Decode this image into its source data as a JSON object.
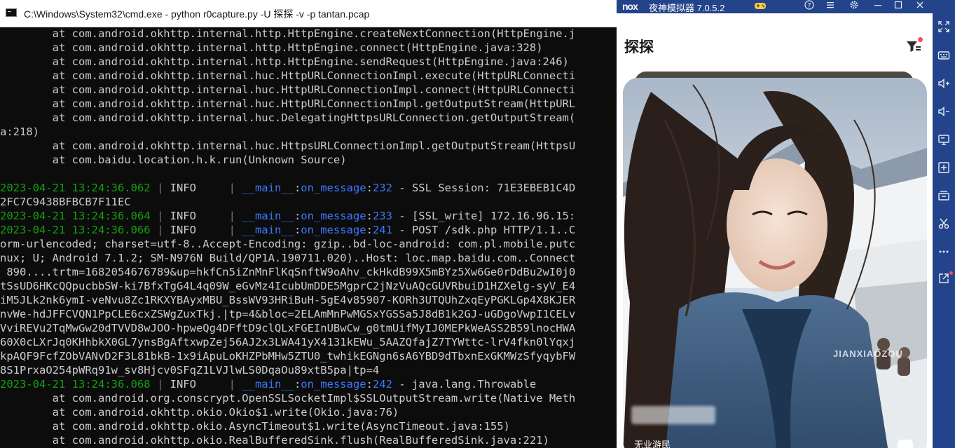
{
  "cmd": {
    "title": "C:\\Windows\\System32\\cmd.exe - python  r0capture.py -U 探探  -v -p tantan.pcap",
    "lines": [
      [
        {
          "t": "        at com.android.okhttp.internal.http.HttpEngine.createNextConnection(HttpEngine.j",
          "c": "gray"
        }
      ],
      [
        {
          "t": "        at com.android.okhttp.internal.http.HttpEngine.connect(HttpEngine.java:328)",
          "c": "gray"
        }
      ],
      [
        {
          "t": "        at com.android.okhttp.internal.http.HttpEngine.sendRequest(HttpEngine.java:246)",
          "c": "gray"
        }
      ],
      [
        {
          "t": "        at com.android.okhttp.internal.huc.HttpURLConnectionImpl.execute(HttpURLConnecti",
          "c": "gray"
        }
      ],
      [
        {
          "t": "        at com.android.okhttp.internal.huc.HttpURLConnectionImpl.connect(HttpURLConnecti",
          "c": "gray"
        }
      ],
      [
        {
          "t": "        at com.android.okhttp.internal.huc.HttpURLConnectionImpl.getOutputStream(HttpURL",
          "c": "gray"
        }
      ],
      [
        {
          "t": "        at com.android.okhttp.internal.huc.DelegatingHttpsURLConnection.getOutputStream(",
          "c": "gray"
        }
      ],
      [
        {
          "t": "a:218)",
          "c": "gray"
        }
      ],
      [
        {
          "t": "        at com.android.okhttp.internal.huc.HttpsURLConnectionImpl.getOutputStream(HttpsU",
          "c": "gray"
        }
      ],
      [
        {
          "t": "        at com.baidu.location.h.k.run(Unknown Source)",
          "c": "gray"
        }
      ],
      [
        {
          "t": "",
          "c": "gray"
        }
      ],
      [
        {
          "t": "2023-04-21 13:24:36.062",
          "c": "green"
        },
        {
          "t": " | ",
          "c": "sep"
        },
        {
          "t": "INFO",
          "c": "gray"
        },
        {
          "t": "     | ",
          "c": "sep"
        },
        {
          "t": "__main__",
          "c": "blue"
        },
        {
          "t": ":",
          "c": "gray"
        },
        {
          "t": "on_message",
          "c": "blue"
        },
        {
          "t": ":",
          "c": "gray"
        },
        {
          "t": "232",
          "c": "blue"
        },
        {
          "t": " - SSL Session: 71E3EBEB1C4D",
          "c": "gray"
        }
      ],
      [
        {
          "t": "2FC7C9438BFBCB7F11EC",
          "c": "gray"
        }
      ],
      [
        {
          "t": "2023-04-21 13:24:36.064",
          "c": "green"
        },
        {
          "t": " | ",
          "c": "sep"
        },
        {
          "t": "INFO",
          "c": "gray"
        },
        {
          "t": "     | ",
          "c": "sep"
        },
        {
          "t": "__main__",
          "c": "blue"
        },
        {
          "t": ":",
          "c": "gray"
        },
        {
          "t": "on_message",
          "c": "blue"
        },
        {
          "t": ":",
          "c": "gray"
        },
        {
          "t": "233",
          "c": "blue"
        },
        {
          "t": " - [SSL_write] 172.16.96.15:",
          "c": "gray"
        }
      ],
      [
        {
          "t": "2023-04-21 13:24:36.066",
          "c": "green"
        },
        {
          "t": " | ",
          "c": "sep"
        },
        {
          "t": "INFO",
          "c": "gray"
        },
        {
          "t": "     | ",
          "c": "sep"
        },
        {
          "t": "__main__",
          "c": "blue"
        },
        {
          "t": ":",
          "c": "gray"
        },
        {
          "t": "on_message",
          "c": "blue"
        },
        {
          "t": ":",
          "c": "gray"
        },
        {
          "t": "241",
          "c": "blue"
        },
        {
          "t": " - POST /sdk.php HTTP/1.1..C",
          "c": "gray"
        }
      ],
      [
        {
          "t": "orm-urlencoded; charset=utf-8..Accept-Encoding: gzip..bd-loc-android: com.pl.mobile.putc",
          "c": "gray"
        }
      ],
      [
        {
          "t": "nux; U; Android 7.1.2; SM-N976N Build/QP1A.190711.020)..Host: loc.map.baidu.com..Connect",
          "c": "gray"
        }
      ],
      [
        {
          "t": " 890....trtm=1682054676789&up=hkfCn5iZnMnFlKqSnftW9oAhv_ckHkdB99X5mBYz5Xw6Ge0rDdBu2wI0j0",
          "c": "gray"
        }
      ],
      [
        {
          "t": "tSsUD6HKcQQpucbbSW-ki7BfxTgG4L4q09W_eGvMz4IcubUmDDE5MgprC2jNzVuAQcGUVRbuiD1HZXelg-syV_E4",
          "c": "gray"
        }
      ],
      [
        {
          "t": "iM5JLk2nk6ymI-veNvu8Zc1RKXYBAyxMBU_BssWV93HRiBuH-5gE4v85907-KORh3UTQUhZxqEyPGKLGp4X8KJER",
          "c": "gray"
        }
      ],
      [
        {
          "t": "nvWe-hdJFFCVQN1PpCLE6cxZSWgZuxTkj.|tp=4&bloc=2ELAmMnPwMGSxYGSSa5J8dB1k2GJ-uGDgoVwpI1CELv",
          "c": "gray"
        }
      ],
      [
        {
          "t": "VviREVu2TqMwGw20dTVVD8wJOO-hpweQg4DFftD9clQLxFGEInUBwCw_g0tmUifMyIJ0MEPkWeASS2B59lnocHWA",
          "c": "gray"
        }
      ],
      [
        {
          "t": "60X0cLXrJq0KHhbkX0GL7ynsBgAftxwpZej56AJ2x3LWA41yX4131kEWu_5AAZQfajZ7TYWttc-lrV4fkn0lYqxj",
          "c": "gray"
        }
      ],
      [
        {
          "t": "kpAQF9FcfZObVANvD2F3L81bkB-1x9iApuLoKHZPbMHw5ZTU0_twhikEGNgn6sA6YBD9dTbxnExGKMWzSfyqybFW",
          "c": "gray"
        }
      ],
      [
        {
          "t": "8S1PrxaO254pWRq91w_sv8Hjcv0SFqZ1LVJlwLS0DqaOu89xtB5pa|tp=4",
          "c": "gray"
        }
      ],
      [
        {
          "t": "2023-04-21 13:24:36.068",
          "c": "green"
        },
        {
          "t": " | ",
          "c": "sep"
        },
        {
          "t": "INFO",
          "c": "gray"
        },
        {
          "t": "     | ",
          "c": "sep"
        },
        {
          "t": "__main__",
          "c": "blue"
        },
        {
          "t": ":",
          "c": "gray"
        },
        {
          "t": "on_message",
          "c": "blue"
        },
        {
          "t": ":",
          "c": "gray"
        },
        {
          "t": "242",
          "c": "blue"
        },
        {
          "t": " - java.lang.Throwable",
          "c": "gray"
        }
      ],
      [
        {
          "t": "        at com.android.org.conscrypt.OpenSSLSocketImpl$SSLOutputStream.write(Native Meth",
          "c": "gray"
        }
      ],
      [
        {
          "t": "        at com.android.okhttp.okio.Okio$1.write(Okio.java:76)",
          "c": "gray"
        }
      ],
      [
        {
          "t": "        at com.android.okhttp.okio.AsyncTimeout$1.write(AsyncTimeout.java:155)",
          "c": "gray"
        }
      ],
      [
        {
          "t": "        at com.android.okhttp.okio.RealBufferedSink.flush(RealBufferedSink.java:221)",
          "c": "gray"
        }
      ]
    ]
  },
  "emulator": {
    "logo": "nox",
    "title": "夜神模拟器 7.0.5.2",
    "top_icons": [
      "gamepad-icon",
      "help-icon",
      "menu-icon",
      "settings-icon",
      "minimize-icon",
      "maximize-icon",
      "close-icon"
    ],
    "side_icons": [
      "fullscreen-icon",
      "keyboard-icon",
      "volume-up-icon",
      "volume-down-icon",
      "screen-icon",
      "apk-install-icon",
      "multi-instance-icon",
      "screenshot-icon",
      "more-icon",
      "open-link-icon"
    ],
    "accent": "#23448a"
  },
  "app": {
    "title": "探探",
    "card": {
      "watermark": "JIANXIAOZOU",
      "user_tag": "无业游民"
    }
  }
}
